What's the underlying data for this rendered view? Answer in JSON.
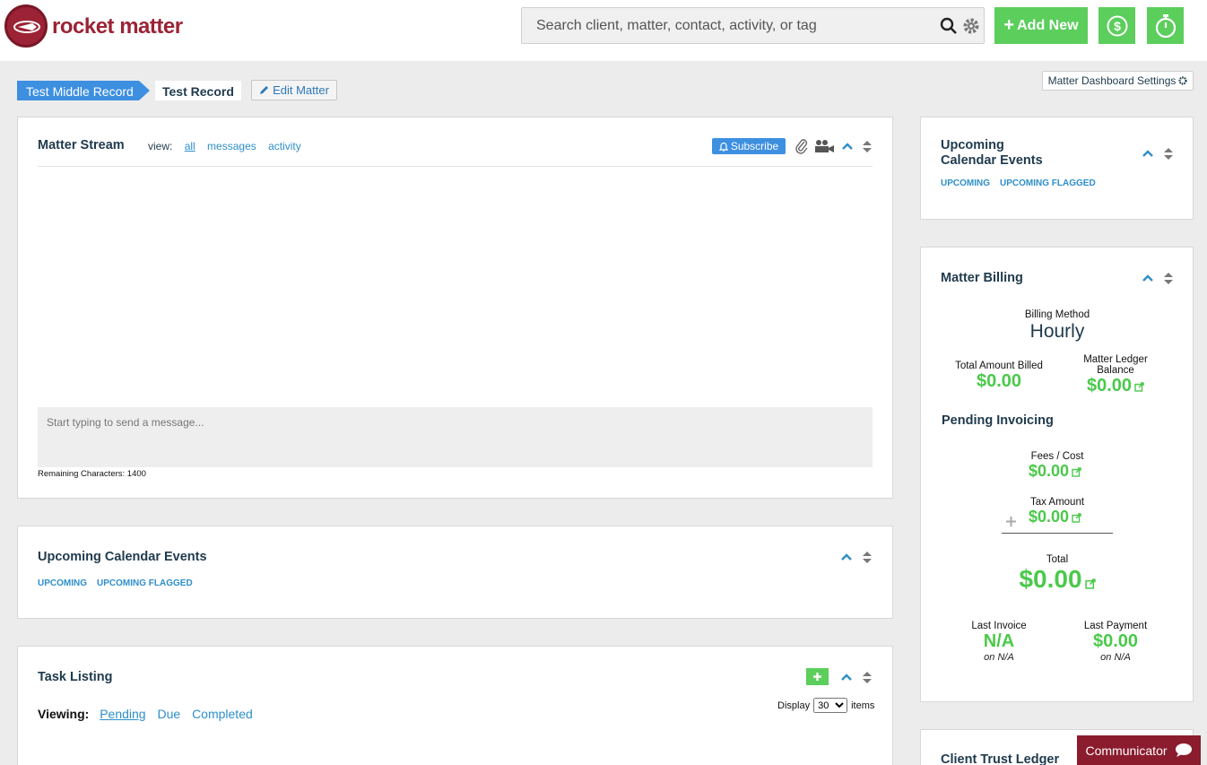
{
  "app": {
    "logo_text": "rocket matter"
  },
  "search": {
    "placeholder": "Search client, matter, contact, activity, or tag"
  },
  "header": {
    "add_new_label": "Add New"
  },
  "breadcrumb": {
    "items": [
      "Test Middle Record",
      "Test Record"
    ]
  },
  "edit_matter_label": "Edit Matter",
  "dashboard_settings_label": "Matter Dashboard Settings",
  "matter_stream": {
    "title": "Matter Stream",
    "view_label": "view:",
    "views": [
      "all",
      "messages",
      "activity"
    ],
    "subscribe_label": "Subscribe",
    "message_placeholder": "Start typing to send a message...",
    "remaining_label": "Remaining Characters: 1400"
  },
  "calendar_main": {
    "title": "Upcoming Calendar Events",
    "links": [
      "UPCOMING",
      "UPCOMING FLAGGED"
    ]
  },
  "task_listing": {
    "title": "Task Listing",
    "viewing_label": "Viewing:",
    "filters": [
      "Pending",
      "Due",
      "Completed"
    ],
    "display_label": "Display",
    "display_value": "30",
    "items_label": "items"
  },
  "calendar_side": {
    "title_line1": "Upcoming",
    "title_line2": "Calendar Events",
    "links": [
      "UPCOMING",
      "UPCOMING FLAGGED"
    ]
  },
  "billing": {
    "title": "Matter Billing",
    "method_label": "Billing Method",
    "method_value": "Hourly",
    "total_billed_label": "Total Amount Billed",
    "total_billed_value": "$0.00",
    "ledger_label_1": "Matter Ledger",
    "ledger_label_2": "Balance",
    "ledger_value": "$0.00",
    "pending_title": "Pending Invoicing",
    "fees_label": "Fees / Cost",
    "fees_value": "$0.00",
    "tax_label": "Tax Amount",
    "tax_value": "$0.00",
    "total_label": "Total",
    "total_value": "$0.00",
    "last_invoice_label": "Last Invoice",
    "last_invoice_value": "N/A",
    "last_invoice_on": "on N/A",
    "last_payment_label": "Last Payment",
    "last_payment_value": "$0.00",
    "last_payment_on": "on N/A"
  },
  "trust": {
    "title": "Client Trust Ledger"
  },
  "communicator_label": "Communicator",
  "colors": {
    "green": "#5bce5b",
    "blue": "#3d8fe0",
    "brand": "#9b2335"
  }
}
